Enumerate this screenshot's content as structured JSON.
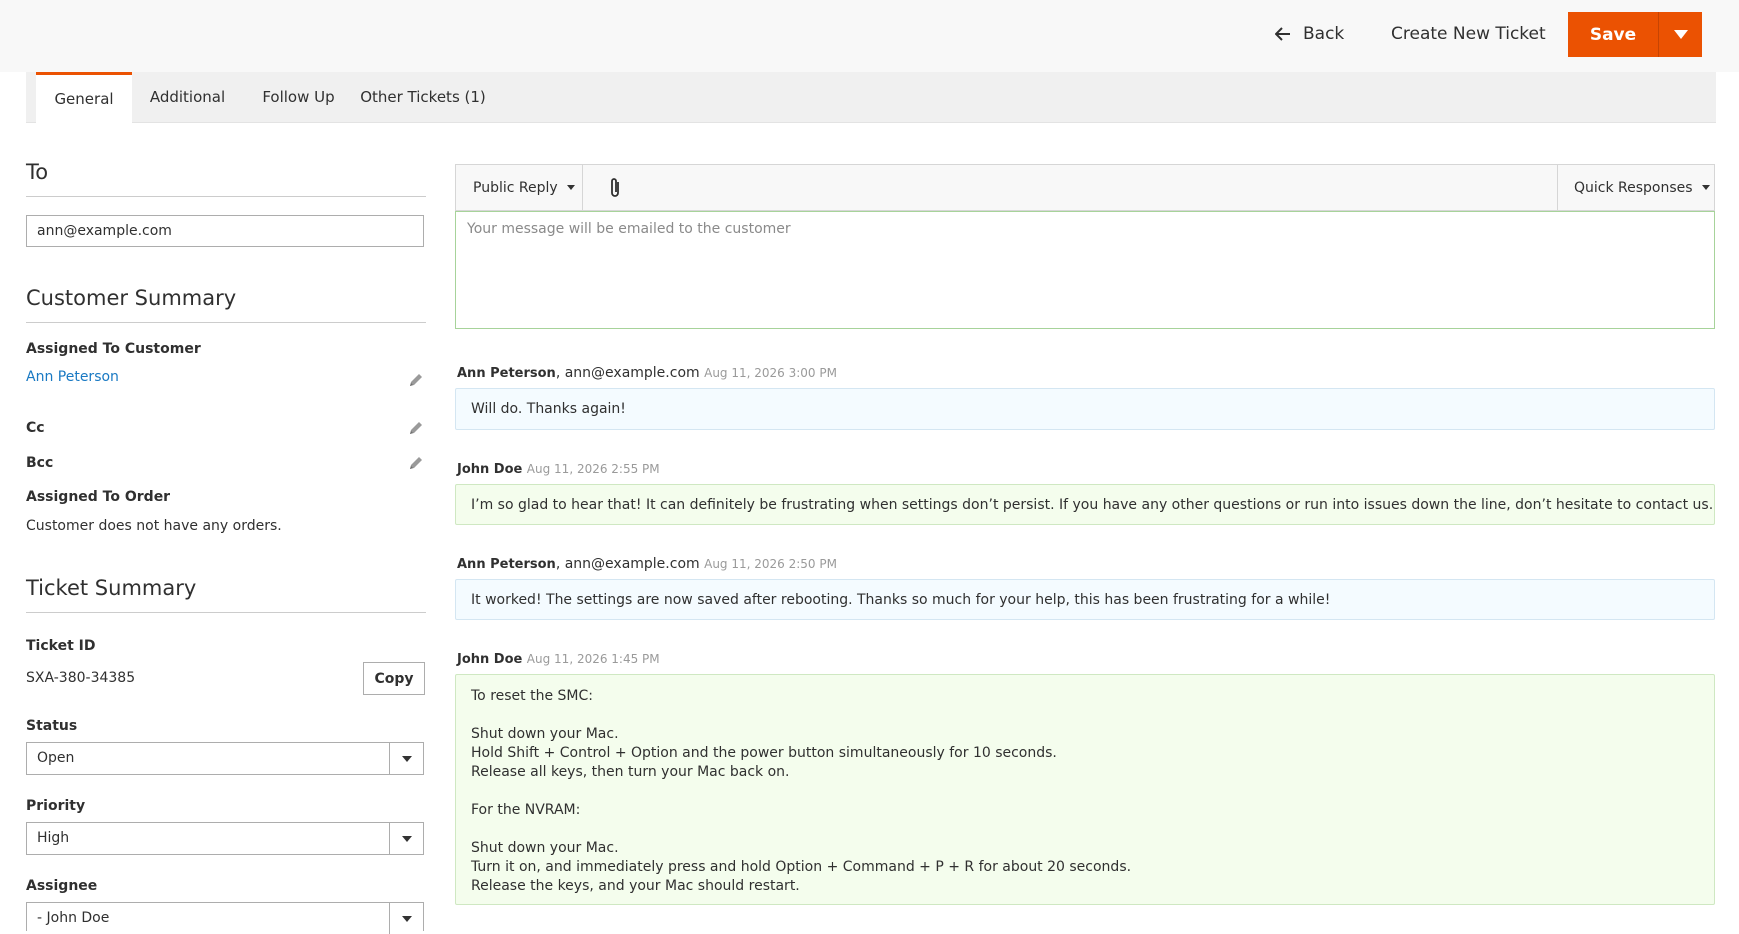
{
  "header": {
    "back_label": "Back",
    "create_label": "Create New Ticket",
    "save_label": "Save"
  },
  "tabs": [
    {
      "label": "General",
      "active": true
    },
    {
      "label": "Additional"
    },
    {
      "label": "Follow Up"
    },
    {
      "label": "Other Tickets (1)"
    }
  ],
  "to": {
    "title": "To",
    "email": "ann@example.com"
  },
  "customer_summary": {
    "title": "Customer Summary",
    "assigned_customer_label": "Assigned To Customer",
    "customer_name": "Ann Peterson",
    "cc_label": "Cc",
    "bcc_label": "Bcc",
    "assigned_order_label": "Assigned To Order",
    "order_text": "Customer does not have any orders."
  },
  "ticket_summary": {
    "title": "Ticket Summary",
    "id_label": "Ticket ID",
    "id_value": "SXA-380-34385",
    "copy_label": "Copy",
    "status_label": "Status",
    "status_value": "Open",
    "priority_label": "Priority",
    "priority_value": "High",
    "assignee_label": "Assignee",
    "assignee_value": "- John Doe"
  },
  "reply": {
    "type_label": "Public Reply",
    "quick_label": "Quick Responses",
    "placeholder": "Your message will be emailed to the customer"
  },
  "messages": [
    {
      "author": "Ann Peterson",
      "email": ", ann@example.com",
      "date": "Aug 11, 2026 3:00 PM",
      "lines": [
        "Will do. Thanks again!"
      ]
    },
    {
      "author": "John Doe",
      "email": "",
      "date": "Aug 11, 2026 2:55 PM",
      "lines": [
        "I’m so glad to hear that! It can definitely be frustrating when settings don’t persist. If you have any other questions or run into issues down the line, don’t hesitate to contact us."
      ]
    },
    {
      "author": "Ann Peterson",
      "email": ", ann@example.com",
      "date": "Aug 11, 2026 2:50 PM",
      "lines": [
        "It worked! The settings are now saved after rebooting. Thanks so much for your help, this has been frustrating for a while!"
      ]
    },
    {
      "author": "John Doe",
      "email": "",
      "date": "Aug 11, 2026 1:45 PM",
      "lines": [
        "To reset the SMC:",
        "",
        "Shut down your Mac.",
        "Hold Shift + Control + Option and the power button simultaneously for 10 seconds.",
        "Release all keys, then turn your Mac back on.",
        "",
        "For the NVRAM:",
        "",
        "Shut down your Mac.",
        "Turn it on, and immediately press and hold Option + Command + P + R for about 20 seconds.",
        "Release the keys, and your Mac should restart."
      ]
    }
  ],
  "icons": {
    "back": "arrow-left-icon",
    "edit": "pencil-icon",
    "attach": "paperclip-icon",
    "dropdown": "chevron-down-icon"
  },
  "colors": {
    "accent": "#eb5202",
    "link": "#1979c3",
    "customer_bubble": "#f4fbff",
    "staff_bubble": "#f4fded"
  }
}
